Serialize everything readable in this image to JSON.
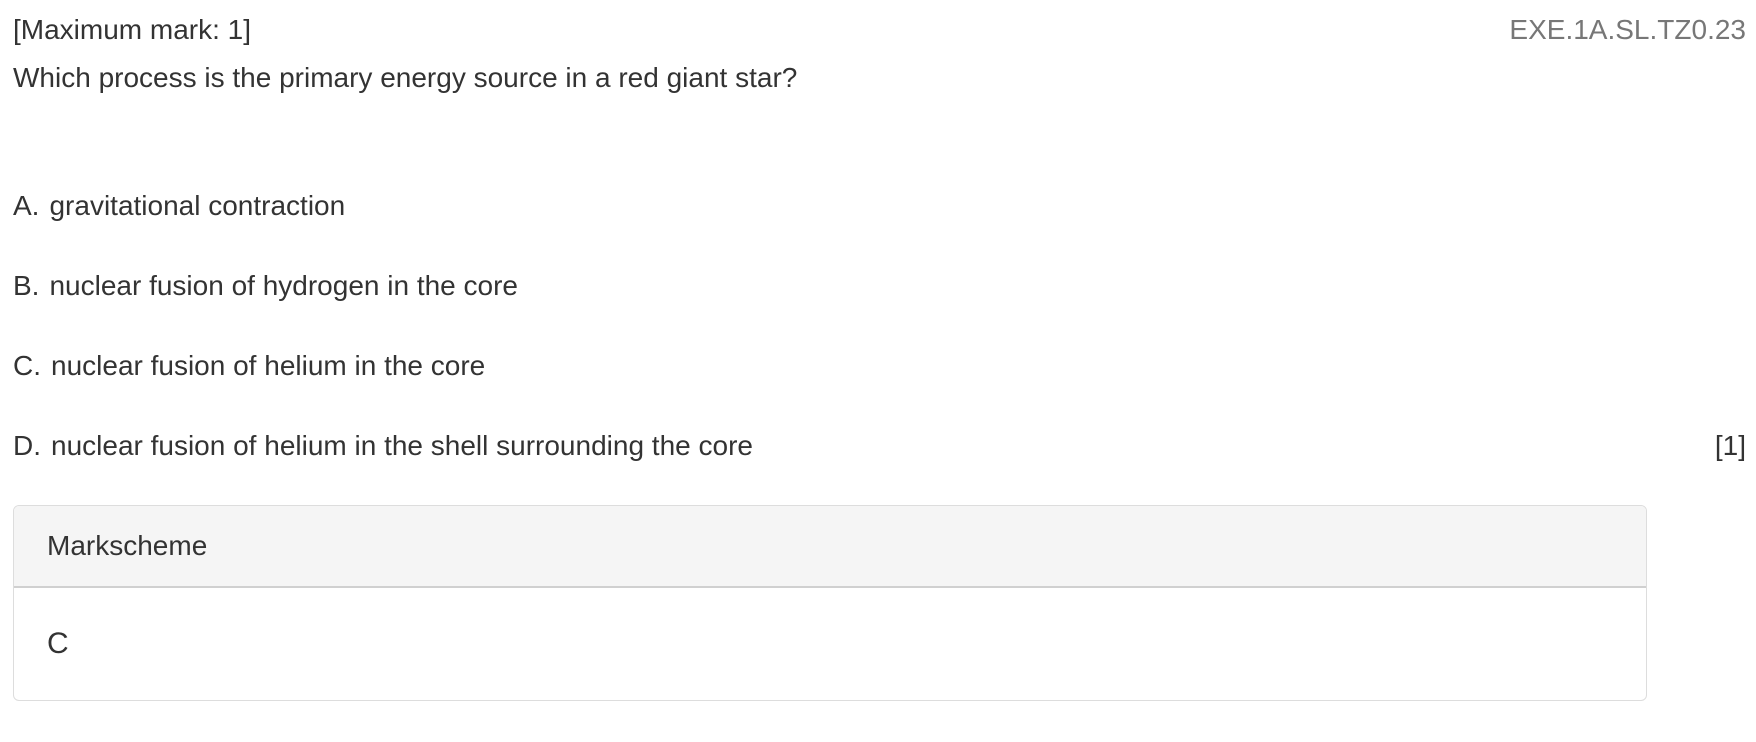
{
  "header": {
    "max_mark": "[Maximum mark: 1]",
    "question_code": "EXE.1A.SL.TZ0.23"
  },
  "question": {
    "text": "Which process is the primary energy source in a red giant star?",
    "options": [
      {
        "letter": "A.",
        "text": "gravitational contraction"
      },
      {
        "letter": "B.",
        "text": "nuclear fusion of hydrogen in the core"
      },
      {
        "letter": "C.",
        "text": "nuclear fusion of helium in the core"
      },
      {
        "letter": "D.",
        "text": "nuclear fusion of helium in the shell surrounding the core"
      }
    ],
    "marks": "[1]"
  },
  "markscheme": {
    "title": "Markscheme",
    "answer": "C"
  }
}
